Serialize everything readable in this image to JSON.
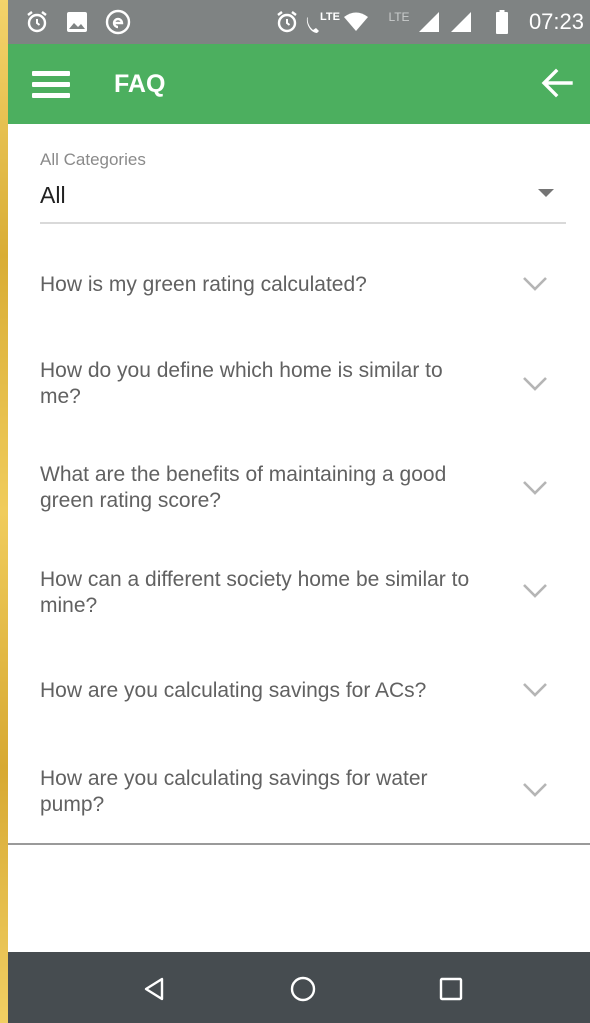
{
  "status_bar": {
    "time": "07:23",
    "left_icons": [
      "alarm-icon",
      "image-icon",
      "app-notification-icon"
    ],
    "right_icons": [
      "alarm-icon",
      "volte-call-icon",
      "wifi-icon",
      "lte-icon",
      "signal-icon",
      "signal-icon",
      "battery-icon"
    ],
    "lte_label": "LTE",
    "lte_label_2": "LTE"
  },
  "app_bar": {
    "title": "FAQ",
    "color": "#4caf5f"
  },
  "category": {
    "label": "All Categories",
    "selected": "All"
  },
  "faqs": [
    {
      "question": "How is my green rating calculated?"
    },
    {
      "question": "How do you define which home is similar to me?"
    },
    {
      "question": "What are the benefits of maintaining a good green rating score?"
    },
    {
      "question": "How can a different society home be similar to mine?"
    },
    {
      "question": "How are you calculating savings for ACs?"
    },
    {
      "question": "How are you calculating savings for water pump?"
    }
  ],
  "nav_bar": {
    "buttons": [
      "back-triangle-icon",
      "home-circle-icon",
      "recents-square-icon"
    ]
  }
}
